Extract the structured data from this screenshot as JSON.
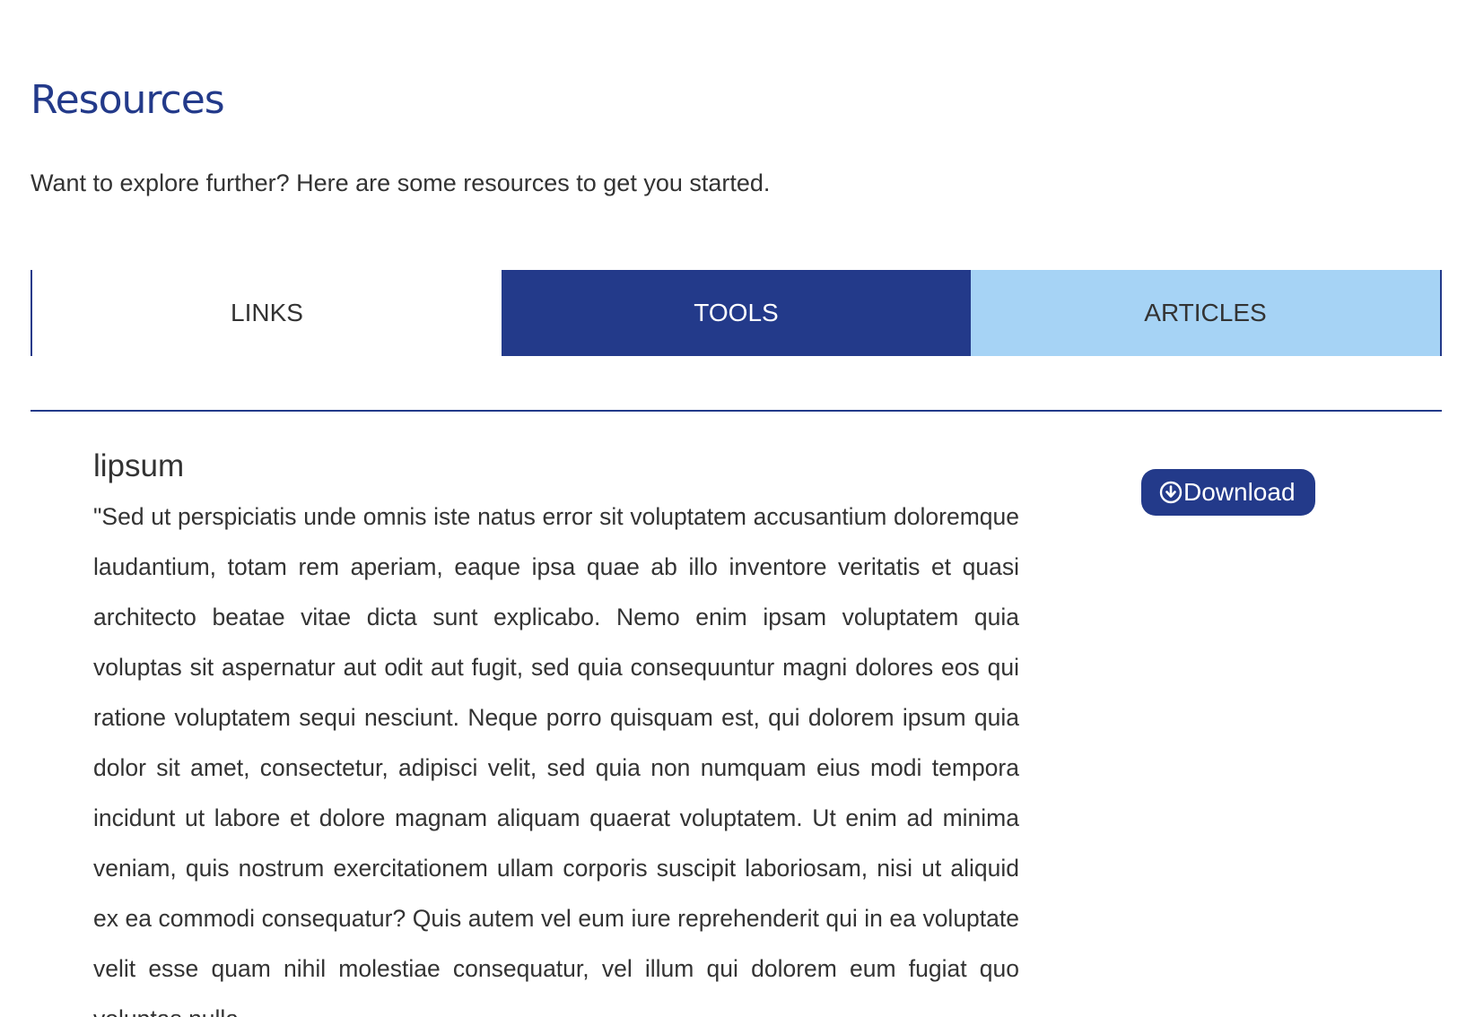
{
  "page": {
    "title": "Resources",
    "intro": "Want to explore further? Here are some resources to get you started."
  },
  "tabs": [
    {
      "label": "LINKS",
      "state": "default"
    },
    {
      "label": "TOOLS",
      "state": "active"
    },
    {
      "label": "ARTICLES",
      "state": "hover"
    }
  ],
  "resource": {
    "title": "lipsum",
    "description": "\"Sed ut perspiciatis unde omnis iste natus error sit voluptatem accusantium doloremque laudantium, totam rem aperiam, eaque ipsa quae ab illo inventore veritatis et quasi architecto beatae vitae dicta sunt explicabo. Nemo enim ipsam voluptatem quia voluptas sit aspernatur aut odit aut fugit, sed quia consequuntur magni dolores eos qui ratione voluptatem sequi nesciunt. Neque porro quisquam est, qui dolorem ipsum quia dolor sit amet, consectetur, adipisci velit, sed quia non numquam eius modi tempora incidunt ut labore et dolore magnam aliquam quaerat voluptatem. Ut enim ad minima veniam, quis nostrum exercitationem ullam corporis suscipit laboriosam, nisi ut aliquid ex ea commodi consequatur? Quis autem vel eum iure reprehenderit qui in ea voluptate velit esse quam nihil molestiae consequatur, vel illum qui dolorem eum fugiat quo voluptas nulla",
    "download_label": "Download",
    "download_icon": "download-circle-icon"
  },
  "colors": {
    "brand_navy": "#233a8a",
    "tab_light_blue": "#a6d3f5",
    "text": "#333333"
  }
}
